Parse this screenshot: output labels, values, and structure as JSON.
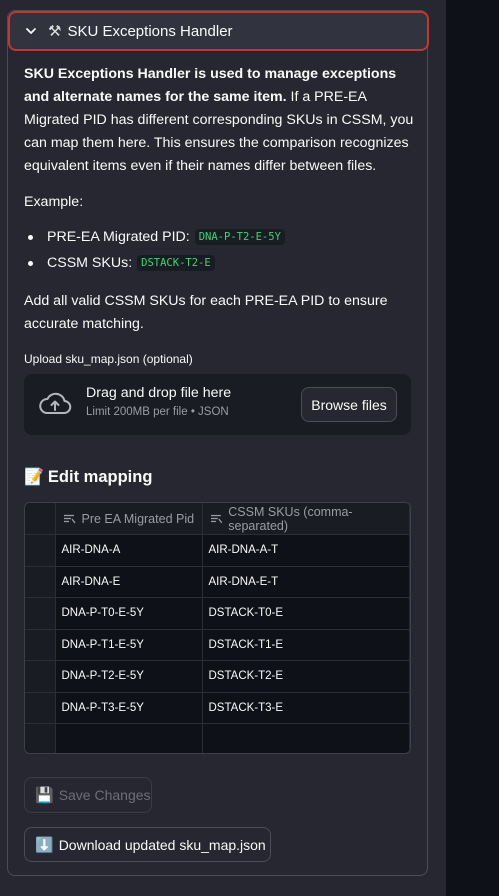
{
  "expander": {
    "title": "SKU Exceptions Handler",
    "expanded": true
  },
  "description": {
    "bold_lead": "SKU Exceptions Handler is used to manage exceptions and alternate names for the same item.",
    "rest": " If a PRE-EA Migrated PID has different corresponding SKUs in CSSM, you can map them here. This ensures the comparison recognizes equivalent items even if their names differ between files."
  },
  "example": {
    "label": "Example:",
    "items": [
      {
        "label": "PRE-EA Migrated PID:",
        "code": "DNA-P-T2-E-5Y"
      },
      {
        "label": "CSSM SKUs:",
        "code": "DSTACK-T2-E"
      }
    ]
  },
  "outro": "Add all valid CSSM SKUs for each PRE-EA PID to ensure accurate matching.",
  "uploader": {
    "label": "Upload sku_map.json (optional)",
    "drop_title": "Drag and drop file here",
    "drop_sub": "Limit 200MB per file • JSON",
    "browse_label": "Browse files",
    "icon": "cloud-upload-icon"
  },
  "editor": {
    "heading": "Edit mapping",
    "columns": [
      "Pre EA Migrated Pid",
      "CSSM SKUs (comma-separated)"
    ],
    "rows": [
      [
        "AIR-DNA-A",
        "AIR-DNA-A-T"
      ],
      [
        "AIR-DNA-E",
        "AIR-DNA-E-T"
      ],
      [
        "DNA-P-T0-E-5Y",
        "DSTACK-T0-E"
      ],
      [
        "DNA-P-T1-E-5Y",
        "DSTACK-T1-E"
      ],
      [
        "DNA-P-T2-E-5Y",
        "DSTACK-T2-E"
      ],
      [
        "DNA-P-T3-E-5Y",
        "DSTACK-T3-E"
      ],
      [
        "",
        ""
      ]
    ]
  },
  "buttons": {
    "save_label": "Save Changes",
    "save_enabled": false,
    "download_label": "Download updated sku_map.json"
  },
  "colors": {
    "accent_red": "#c0392b",
    "code_green": "#3dd56d",
    "background": "#262730"
  }
}
